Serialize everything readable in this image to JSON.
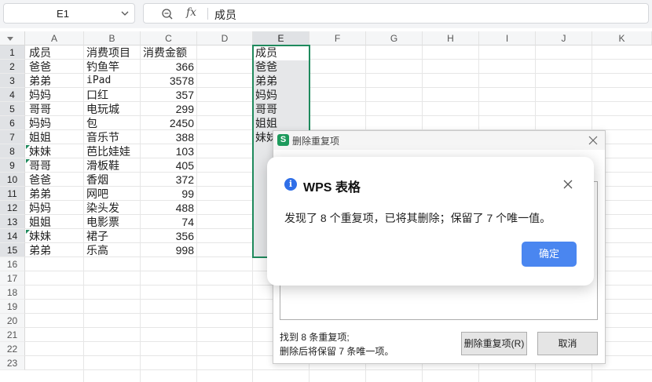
{
  "formula_bar": {
    "cell_name": "E1",
    "fx_label": "fx",
    "content": "成员"
  },
  "columns": [
    "A",
    "B",
    "C",
    "D",
    "E",
    "F",
    "G",
    "H",
    "I",
    "J",
    "K"
  ],
  "rows": [
    "1",
    "2",
    "3",
    "4",
    "5",
    "6",
    "7",
    "8",
    "9",
    "10",
    "11",
    "12",
    "13",
    "14",
    "15",
    "16",
    "17",
    "18",
    "19",
    "20",
    "21",
    "22",
    "23"
  ],
  "cells": {
    "A": [
      "成员",
      "爸爸",
      "弟弟",
      "妈妈",
      "哥哥",
      "妈妈",
      "姐姐",
      "妹妹",
      "哥哥",
      "爸爸",
      "弟弟",
      "妈妈",
      "姐姐",
      "妹妹",
      "弟弟"
    ],
    "B": [
      "消费项目",
      "钓鱼竿",
      "iPad",
      "口红",
      "电玩城",
      "包",
      "音乐节",
      "芭比娃娃",
      "滑板鞋",
      "香烟",
      "网吧",
      "染头发",
      "电影票",
      "裙子",
      "乐高"
    ],
    "C": [
      "消费金额",
      "366",
      "3578",
      "357",
      "299",
      "2450",
      "388",
      "103",
      "405",
      "372",
      "99",
      "488",
      "74",
      "356",
      "998"
    ],
    "E": [
      "成员",
      "爸爸",
      "弟弟",
      "妈妈",
      "哥哥",
      "姐姐",
      "妹妹"
    ]
  },
  "remove_dup_dialog": {
    "title": "删除重复项",
    "found_text": "找到 8 条重复项;",
    "keep_text": "删除后将保留 7 条唯一项。",
    "remove_button": "删除重复项(R)",
    "cancel_button": "取消"
  },
  "alert": {
    "title": "WPS 表格",
    "message": "发现了 8 个重复项，已将其删除；保留了 7 个唯一值。",
    "ok_button": "确定"
  }
}
